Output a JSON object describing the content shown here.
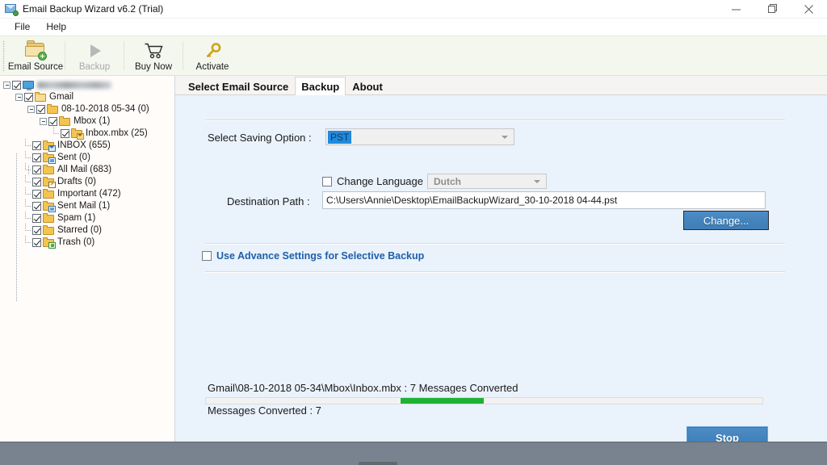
{
  "window": {
    "title": "Email Backup Wizard v6.2 (Trial)",
    "icon": "envelope-app-icon",
    "controls": {
      "minimize": "minimize-icon",
      "restore": "restore-icon",
      "close": "close-icon"
    }
  },
  "menubar": {
    "items": [
      {
        "label": "File"
      },
      {
        "label": "Help"
      }
    ]
  },
  "toolbar": {
    "buttons": [
      {
        "label": "Email Source",
        "icon": "folder-add-icon",
        "disabled": false
      },
      {
        "label": "Backup",
        "icon": "play-icon",
        "disabled": true
      },
      {
        "label": "Buy Now",
        "icon": "cart-icon",
        "disabled": false
      },
      {
        "label": "Activate",
        "icon": "key-icon",
        "disabled": false
      }
    ]
  },
  "sidebar": {
    "tree": [
      {
        "label": "",
        "redacted": true,
        "icon": "monitor-icon",
        "checked": true,
        "expander": "collapse",
        "depth": 0
      },
      {
        "label": "Gmail",
        "icon": "folder-open-icon",
        "checked": true,
        "expander": "collapse",
        "depth": 1
      },
      {
        "label": "08-10-2018 05-34 (0)",
        "icon": "folder-icon",
        "checked": true,
        "expander": "collapse",
        "depth": 2
      },
      {
        "label": "Mbox (1)",
        "icon": "folder-icon",
        "checked": true,
        "expander": "collapse",
        "depth": 3
      },
      {
        "label": "Inbox.mbx (25)",
        "icon": "folder-mbx-icon",
        "checked": true,
        "expander": "none",
        "depth": 4
      },
      {
        "label": "INBOX (655)",
        "icon": "folder-mail-icon",
        "checked": true,
        "expander": "none",
        "depth": 2
      },
      {
        "label": "Sent (0)",
        "icon": "folder-sent-icon",
        "checked": true,
        "expander": "none",
        "depth": 2
      },
      {
        "label": "All Mail (683)",
        "icon": "folder-icon",
        "checked": true,
        "expander": "none",
        "depth": 2
      },
      {
        "label": "Drafts (0)",
        "icon": "folder-draft-icon",
        "checked": true,
        "expander": "none",
        "depth": 2
      },
      {
        "label": "Important (472)",
        "icon": "folder-icon",
        "checked": true,
        "expander": "none",
        "depth": 2
      },
      {
        "label": "Sent Mail (1)",
        "icon": "folder-sent-icon",
        "checked": true,
        "expander": "none",
        "depth": 2
      },
      {
        "label": "Spam (1)",
        "icon": "folder-icon",
        "checked": true,
        "expander": "none",
        "depth": 2
      },
      {
        "label": "Starred (0)",
        "icon": "folder-icon",
        "checked": true,
        "expander": "none",
        "depth": 2
      },
      {
        "label": "Trash (0)",
        "icon": "folder-trash-icon",
        "checked": true,
        "expander": "none",
        "depth": 2
      }
    ]
  },
  "tabs": [
    {
      "label": "Select Email Source",
      "active": false
    },
    {
      "label": "Backup",
      "active": true
    },
    {
      "label": "About",
      "active": false
    }
  ],
  "backup": {
    "saving_option_label": "Select Saving Option :",
    "saving_option_value": "PST",
    "change_language_label": "Change Language",
    "change_language_checked": false,
    "language_value": "Dutch",
    "language_enabled": false,
    "destination_label": "Destination Path :",
    "destination_value": "C:\\Users\\Annie\\Desktop\\EmailBackupWizard_30-10-2018 04-44.pst",
    "change_button": "Change...",
    "advance_settings_label": "Use Advance Settings for Selective Backup",
    "advance_settings_checked": false
  },
  "progress": {
    "current_item": "Gmail\\08-10-2018 05-34\\Mbox\\Inbox.mbx : 7 Messages Converted",
    "summary": "Messages Converted : 7",
    "bar_style": "marquee",
    "chunk_start_pct": 35,
    "chunk_width_pct": 15,
    "chunk_color": "#1eb234"
  },
  "stop_button": "Stop",
  "colors": {
    "panel_bg": "#eaf2fc",
    "sidebar_bg": "#fffcfa",
    "toolbar_bg": "#f3f7ee",
    "accent_blue": "#4484bd",
    "link_blue": "#1f5fa8",
    "progress_green": "#1eb234",
    "bottom_bar": "#78838f"
  }
}
